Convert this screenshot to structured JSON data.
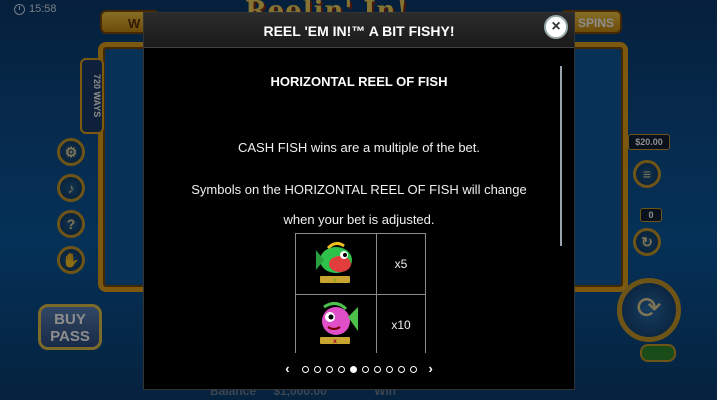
{
  "status": {
    "time": "15:58"
  },
  "game": {
    "logo_text": "Reelin' In!",
    "win_tab": "W",
    "spins_tab": "SPINS",
    "ways_badge": "720 WAYS",
    "buy_pass_label": "BUY PASS",
    "bet_value": "$20.00",
    "autoplay_count": "0",
    "balance_label": "Balance",
    "balance_value": "$1,000.00",
    "win_label": "Win"
  },
  "modal": {
    "title": "REEL 'EM IN!™ A BIT FISHY!",
    "close_label": "×",
    "section_title": "HORIZONTAL REEL OF FISH",
    "para1": "CASH FISH wins are a multiple of the bet.",
    "para2_line1": "Symbols on the HORIZONTAL REEL OF FISH will change",
    "para2_line2": "when your bet is adjusted.",
    "pay_rows": [
      {
        "symbol": "green-cash-fish",
        "multiplier": "x5"
      },
      {
        "symbol": "pink-cash-fish",
        "multiplier": "x10"
      }
    ],
    "pager": {
      "prev": "‹",
      "next": "›",
      "total_pages": 10,
      "current_page": 5
    }
  },
  "colors": {
    "accent_gold": "#e2a21c",
    "modal_bg": "#000000"
  }
}
